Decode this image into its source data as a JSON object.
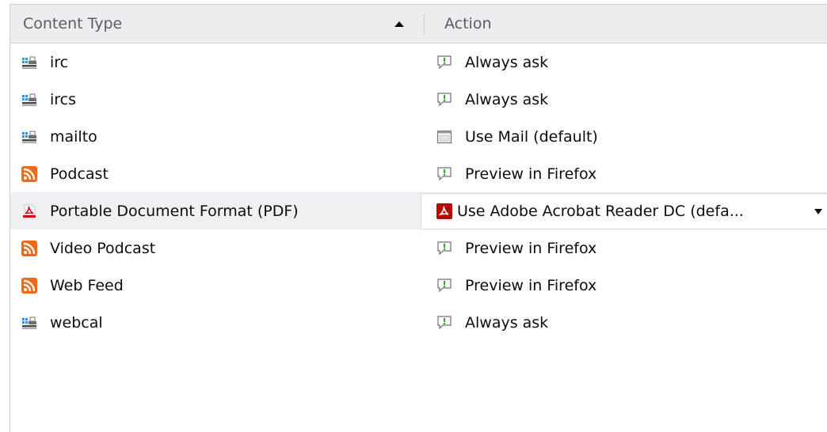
{
  "header": {
    "content_type": "Content Type",
    "action": "Action"
  },
  "rows": [
    {
      "type": "irc",
      "type_icon": "protocol-icon",
      "action": "Always ask",
      "action_icon": "always-ask-icon",
      "selected": false
    },
    {
      "type": "ircs",
      "type_icon": "protocol-icon",
      "action": "Always ask",
      "action_icon": "always-ask-icon",
      "selected": false
    },
    {
      "type": "mailto",
      "type_icon": "protocol-icon",
      "action": "Use Mail (default)",
      "action_icon": "app-window-icon",
      "selected": false
    },
    {
      "type": "Podcast",
      "type_icon": "feed-icon",
      "action": "Preview in Firefox",
      "action_icon": "always-ask-icon",
      "selected": false
    },
    {
      "type": "Portable Document Format (PDF)",
      "type_icon": "pdf-icon",
      "action": "Use Adobe Acrobat Reader DC  (defa...",
      "action_icon": "acrobat-icon",
      "selected": true
    },
    {
      "type": "Video Podcast",
      "type_icon": "feed-icon",
      "action": "Preview in Firefox",
      "action_icon": "always-ask-icon",
      "selected": false
    },
    {
      "type": "Web Feed",
      "type_icon": "feed-icon",
      "action": "Preview in Firefox",
      "action_icon": "always-ask-icon",
      "selected": false
    },
    {
      "type": "webcal",
      "type_icon": "protocol-icon",
      "action": "Always ask",
      "action_icon": "always-ask-icon",
      "selected": false
    }
  ],
  "colors": {
    "header_bg": "#ededf0",
    "selected_row_bg": "#f0f0f4",
    "feed_orange": "#ef6a16",
    "acrobat_red": "#b30b00"
  }
}
